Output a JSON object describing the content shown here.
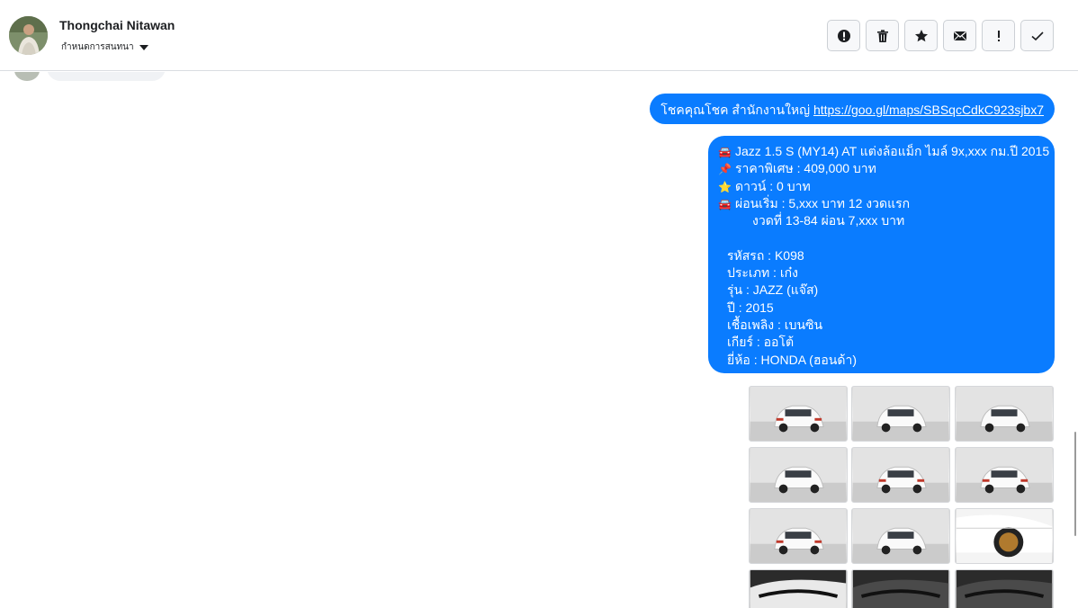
{
  "header": {
    "contact_name": "Thongchai Nitawan",
    "label_dropdown": "กำหนดการสนทนา",
    "actions": [
      {
        "name": "spam",
        "icon": "alert-circle-icon"
      },
      {
        "name": "delete",
        "icon": "trash-icon"
      },
      {
        "name": "star",
        "icon": "star-icon"
      },
      {
        "name": "mark-unread",
        "icon": "envelope-icon"
      },
      {
        "name": "important",
        "icon": "exclamation-icon"
      },
      {
        "name": "done",
        "icon": "checkmark-icon"
      }
    ]
  },
  "messages": {
    "link_message": {
      "prefix": "โชคคุณโชค สำนักงานใหญ่ ",
      "url": "https://goo.gl/maps/SBSqcCdkC923sjbx7"
    },
    "details": {
      "line1": "Jazz 1.5 S (MY14) AT แต่งล้อแม็ก ไมล์ 9x,xxx กม.ปี 2015",
      "line2": "ราคาพิเศษ : 409,000 บาท",
      "line3": "ดาวน์ : 0 บาท",
      "line4": "ผ่อนเริ่ม : 5,xxx บาท 12 งวดแรก",
      "line5": "งวดที่ 13-84 ผ่อน 7,xxx บาท",
      "line6": "รหัสรถ : K098",
      "line7": "ประเภท : เก๋ง",
      "line8": "รุ่น : JAZZ (แจ๊ส)",
      "line9": "ปี : 2015",
      "line10": "เชื้อเพลิง : เบนซิน",
      "line11": "เกียร์ : ออโต้",
      "line12": "ยี่ห้อ : HONDA (ฮอนด้า)",
      "emoji1": "🚘",
      "emoji2": "📌",
      "emoji3": "⭐",
      "emoji4": "🚘"
    },
    "images": [
      "car-rear-open-trunk",
      "car-front-three-quarter",
      "car-front",
      "car-front-left",
      "car-rear-three-quarter",
      "car-rear",
      "car-rear-left",
      "car-side",
      "car-wheel-closeup",
      "car-interior-door",
      "car-interior-dashboard",
      "car-interior-console"
    ]
  },
  "colors": {
    "bubble": "#0a7cff",
    "header_border": "#dadde1",
    "button_border": "#ccd0d5"
  }
}
